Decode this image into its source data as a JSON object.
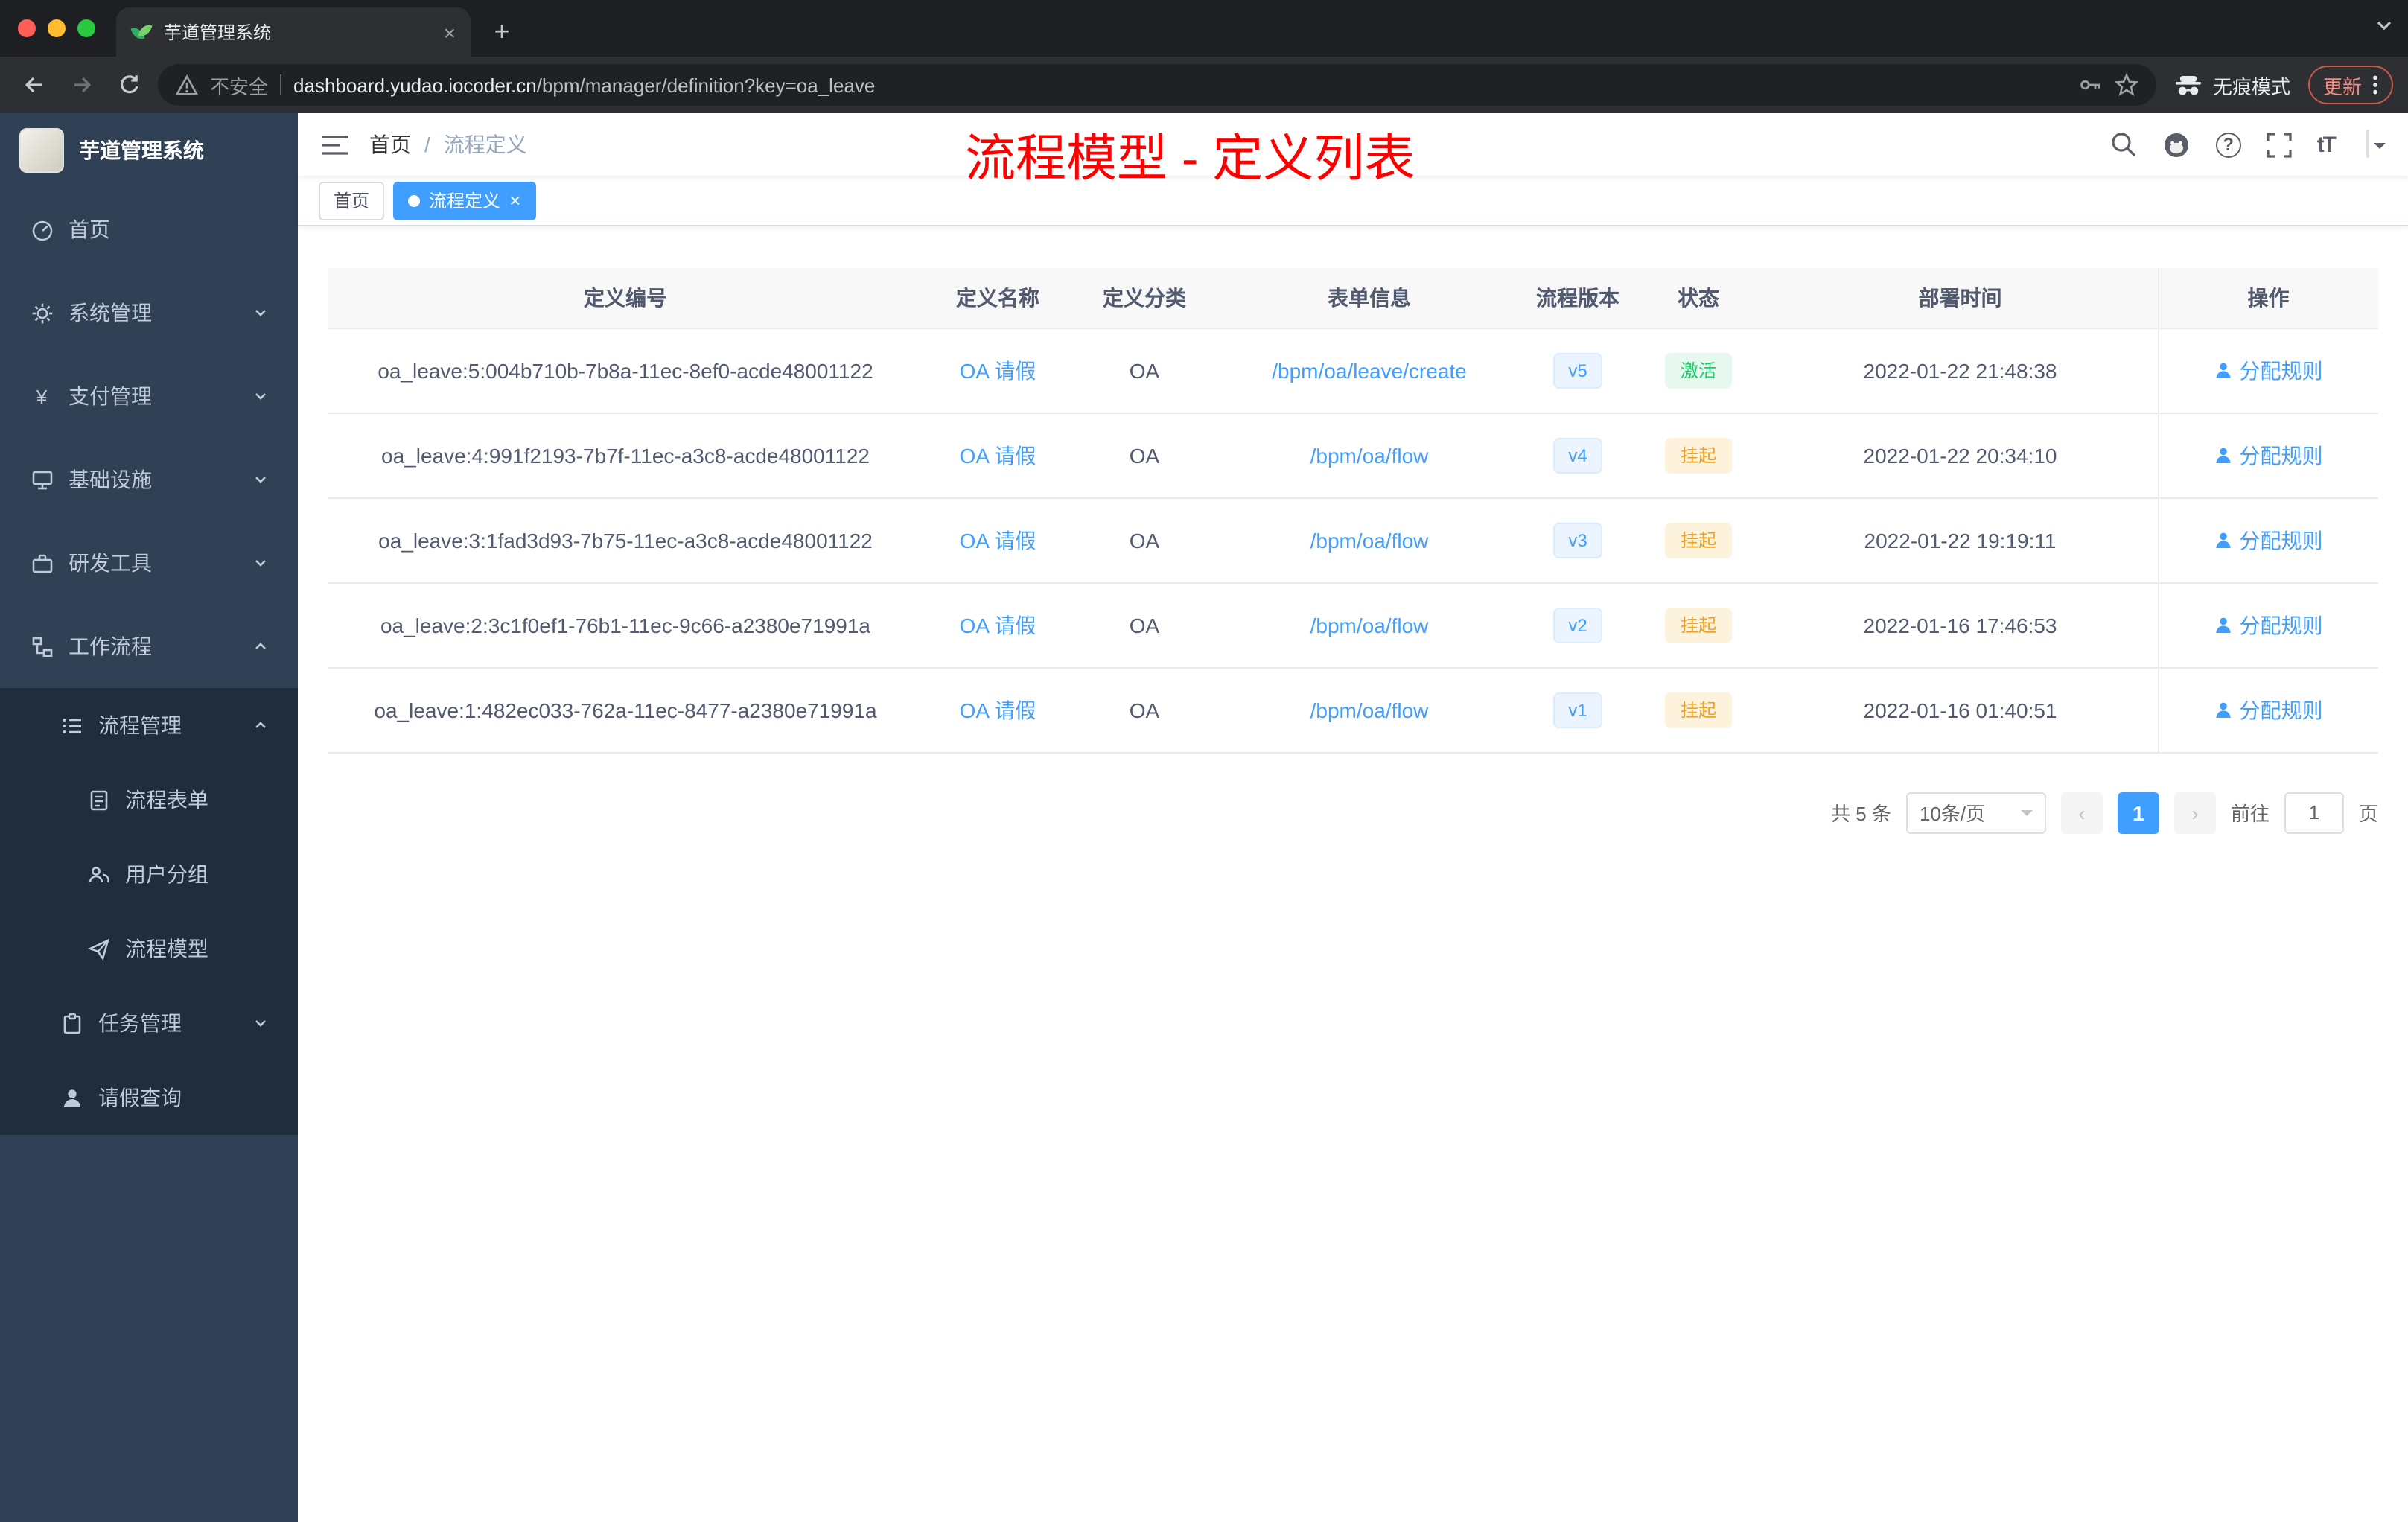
{
  "browser": {
    "tab_title": "芋道管理系统",
    "new_tab_label": "+",
    "security_label": "不安全",
    "url_domain": "dashboard.yudao.iocoder.cn",
    "url_path": "/bpm/manager/definition?key=oa_leave",
    "incognito_label": "无痕模式",
    "update_label": "更新"
  },
  "sidebar": {
    "logo_title": "芋道管理系统",
    "items": [
      {
        "label": "首页"
      },
      {
        "label": "系统管理"
      },
      {
        "label": "支付管理"
      },
      {
        "label": "基础设施"
      },
      {
        "label": "研发工具"
      },
      {
        "label": "工作流程"
      },
      {
        "label": "流程管理"
      },
      {
        "label": "流程表单"
      },
      {
        "label": "用户分组"
      },
      {
        "label": "流程模型"
      },
      {
        "label": "任务管理"
      },
      {
        "label": "请假查询"
      }
    ]
  },
  "header": {
    "breadcrumb_home": "首页",
    "breadcrumb_sep": "/",
    "breadcrumb_current": "流程定义",
    "overlay_title": "流程模型 - 定义列表"
  },
  "tags": {
    "home": "首页",
    "active": "流程定义",
    "close": "×"
  },
  "table": {
    "columns": [
      "定义编号",
      "定义名称",
      "定义分类",
      "表单信息",
      "流程版本",
      "状态",
      "部署时间",
      "操作"
    ],
    "rows": [
      {
        "id": "oa_leave:5:004b710b-7b8a-11ec-8ef0-acde48001122",
        "name": "OA 请假",
        "category": "OA",
        "form": "/bpm/oa/leave/create",
        "version": "v5",
        "status": "激活",
        "time": "2022-01-22 21:48:38",
        "action": "分配规则"
      },
      {
        "id": "oa_leave:4:991f2193-7b7f-11ec-a3c8-acde48001122",
        "name": "OA 请假",
        "category": "OA",
        "form": "/bpm/oa/flow",
        "version": "v4",
        "status": "挂起",
        "time": "2022-01-22 20:34:10",
        "action": "分配规则"
      },
      {
        "id": "oa_leave:3:1fad3d93-7b75-11ec-a3c8-acde48001122",
        "name": "OA 请假",
        "category": "OA",
        "form": "/bpm/oa/flow",
        "version": "v3",
        "status": "挂起",
        "time": "2022-01-22 19:19:11",
        "action": "分配规则"
      },
      {
        "id": "oa_leave:2:3c1f0ef1-76b1-11ec-9c66-a2380e71991a",
        "name": "OA 请假",
        "category": "OA",
        "form": "/bpm/oa/flow",
        "version": "v2",
        "status": "挂起",
        "time": "2022-01-16 17:46:53",
        "action": "分配规则"
      },
      {
        "id": "oa_leave:1:482ec033-762a-11ec-8477-a2380e71991a",
        "name": "OA 请假",
        "category": "OA",
        "form": "/bpm/oa/flow",
        "version": "v1",
        "status": "挂起",
        "time": "2022-01-16 01:40:51",
        "action": "分配规则"
      }
    ]
  },
  "pagination": {
    "total": "共 5 条",
    "page_size": "10条/页",
    "prev": "‹",
    "current_page": "1",
    "next": "›",
    "goto_label": "前往",
    "goto_value": "1",
    "page_unit": "页"
  },
  "colors": {
    "accent_blue": "#409eff",
    "status_active_green": "#13ce66",
    "status_suspend_orange": "#f0a020",
    "annotation_red": "#ff0000",
    "sidebar_bg": "#304156",
    "sidebar_submenu_bg": "#1f2d3d"
  }
}
